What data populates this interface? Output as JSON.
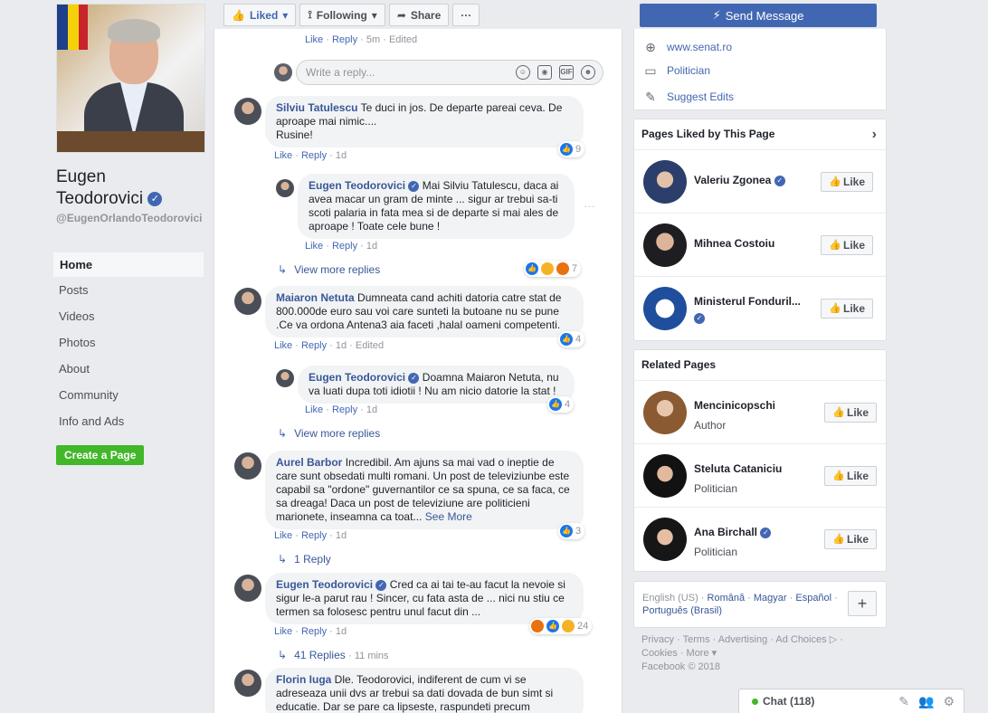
{
  "page": {
    "name_line1": "Eugen",
    "name_line2": "Teodorovici",
    "handle": "@EugenOrlandoTeodorovici"
  },
  "left_nav": {
    "items": [
      {
        "label": "Home"
      },
      {
        "label": "Posts"
      },
      {
        "label": "Videos"
      },
      {
        "label": "Photos"
      },
      {
        "label": "About"
      },
      {
        "label": "Community"
      },
      {
        "label": "Info and Ads"
      }
    ],
    "create_page_label": "Create a Page"
  },
  "action_bar": {
    "liked_label": "Liked",
    "following_label": "Following",
    "share_label": "Share",
    "more_label": "···",
    "send_message_label": "Send Message"
  },
  "feed": {
    "top_meta": {
      "like": "Like",
      "reply": "Reply",
      "time": "5m",
      "edited": "Edited"
    },
    "reply_placeholder": "Write a reply...",
    "comments": [
      {
        "author": "Silviu Tatulescu",
        "text": " Te duci in jos. De departe pareai ceva. De aproape mai nimic....",
        "text2": "Rusine!",
        "like": "Like",
        "reply": "Reply",
        "time": "1d",
        "reactions": "9"
      },
      {
        "author": "Eugen Teodorovici",
        "text": " Mai Silviu Tatulescu, daca ai avea macar un gram de minte ... sigur ar trebui sa-ti scoti palaria in fata mea si de departe si mai ales de aproape ! Toate cele bune !",
        "like": "Like",
        "reply": "Reply",
        "time": "1d",
        "reactions": "7"
      },
      {
        "author": "Maiaron Netuta",
        "text": " Dumneata cand achiti datoria catre stat de 800.000de euro sau voi care sunteti la butoane nu se pune .Ce va ordona Antena3 aia faceti ,halal oameni competenti.",
        "like": "Like",
        "reply": "Reply",
        "time": "1d",
        "edited": "Edited",
        "reactions": "4"
      },
      {
        "author": "Eugen Teodorovici",
        "text": " Doamna Maiaron Netuta, nu va luati dupa toti idiotii ! Nu am nicio datorie la stat !",
        "like": "Like",
        "reply": "Reply",
        "time": "1d",
        "reactions": "4"
      },
      {
        "author": "Aurel Barbor",
        "text": " Incredibil. Am ajuns sa mai vad o ineptie de care sunt obsedati multi romani. Un post de televiziunbe este capabil sa \"ordone\" guvernantilor ce sa spuna, ce sa faca, ce sa dreaga! Daca un post de televiziune are politicieni marionete, inseamna ca toat...",
        "see_more": "See More",
        "like": "Like",
        "reply": "Reply",
        "time": "1d",
        "reactions": "3"
      },
      {
        "author": "Eugen Teodorovici",
        "text": " Cred ca ai tai te-au facut la nevoie si sigur le-a parut rau ! Sincer, cu fata asta de ... nici nu stiu ce termen sa folosesc pentru unul facut din ...",
        "like": "Like",
        "reply": "Reply",
        "time": "1d",
        "reactions": "24"
      },
      {
        "author": "Florin Iuga",
        "text": " Dle. Teodorovici, indiferent de cum vi se adreseaza unii dvs ar trebui sa dati dovada de bun simt si educatie. Dar se pare ca lipseste, raspundeti precum \"mitraliera\". Iar ca lider al"
      }
    ],
    "view_more_replies": "View more replies",
    "one_reply": "1 Reply",
    "replies_41": "41 Replies",
    "replies_41_time": "11 mins"
  },
  "about_info": {
    "website": "www.senat.ro",
    "category": "Politician",
    "suggest_edits": "Suggest Edits"
  },
  "pages_liked": {
    "title": "Pages Liked by This Page",
    "items": [
      {
        "name": "Valeriu Zgonea",
        "like": "Like"
      },
      {
        "name": "Mihnea Costoiu",
        "like": "Like"
      },
      {
        "name": "Ministerul Fonduril...",
        "like": "Like"
      }
    ]
  },
  "related_pages": {
    "title": "Related Pages",
    "items": [
      {
        "name": "Mencinicopschi",
        "sub": "Author",
        "like": "Like"
      },
      {
        "name": "Steluta Cataniciu",
        "sub": "Politician",
        "like": "Like"
      },
      {
        "name": "Ana Birchall",
        "sub": "Politician",
        "like": "Like"
      }
    ]
  },
  "languages": {
    "current": "English (US)",
    "options": [
      "Română",
      "Magyar",
      "Español",
      "Português (Brasil)"
    ],
    "add_label": "+"
  },
  "footer": {
    "links": [
      "Privacy",
      "Terms",
      "Advertising",
      "Ad Choices",
      "Cookies",
      "More"
    ],
    "copyright": "Facebook © 2018"
  },
  "chat": {
    "label": "Chat (118)"
  },
  "colors": {
    "brand_blue": "#4267b2",
    "link_blue": "#385898",
    "create_green": "#42b72a"
  }
}
